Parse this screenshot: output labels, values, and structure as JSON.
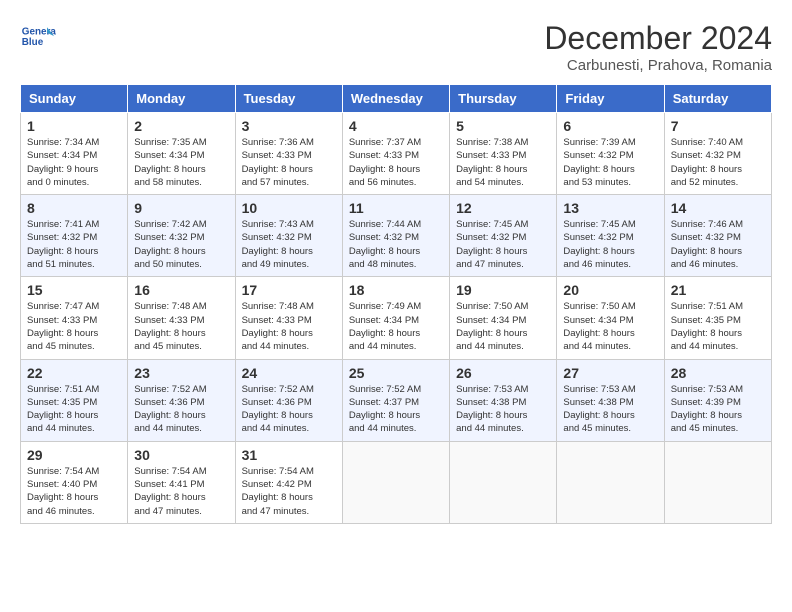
{
  "header": {
    "logo_line1": "General",
    "logo_line2": "Blue",
    "title": "December 2024",
    "subtitle": "Carbunesti, Prahova, Romania"
  },
  "days_of_week": [
    "Sunday",
    "Monday",
    "Tuesday",
    "Wednesday",
    "Thursday",
    "Friday",
    "Saturday"
  ],
  "weeks": [
    [
      {
        "day": 1,
        "info": "Sunrise: 7:34 AM\nSunset: 4:34 PM\nDaylight: 9 hours\nand 0 minutes."
      },
      {
        "day": 2,
        "info": "Sunrise: 7:35 AM\nSunset: 4:34 PM\nDaylight: 8 hours\nand 58 minutes."
      },
      {
        "day": 3,
        "info": "Sunrise: 7:36 AM\nSunset: 4:33 PM\nDaylight: 8 hours\nand 57 minutes."
      },
      {
        "day": 4,
        "info": "Sunrise: 7:37 AM\nSunset: 4:33 PM\nDaylight: 8 hours\nand 56 minutes."
      },
      {
        "day": 5,
        "info": "Sunrise: 7:38 AM\nSunset: 4:33 PM\nDaylight: 8 hours\nand 54 minutes."
      },
      {
        "day": 6,
        "info": "Sunrise: 7:39 AM\nSunset: 4:32 PM\nDaylight: 8 hours\nand 53 minutes."
      },
      {
        "day": 7,
        "info": "Sunrise: 7:40 AM\nSunset: 4:32 PM\nDaylight: 8 hours\nand 52 minutes."
      }
    ],
    [
      {
        "day": 8,
        "info": "Sunrise: 7:41 AM\nSunset: 4:32 PM\nDaylight: 8 hours\nand 51 minutes."
      },
      {
        "day": 9,
        "info": "Sunrise: 7:42 AM\nSunset: 4:32 PM\nDaylight: 8 hours\nand 50 minutes."
      },
      {
        "day": 10,
        "info": "Sunrise: 7:43 AM\nSunset: 4:32 PM\nDaylight: 8 hours\nand 49 minutes."
      },
      {
        "day": 11,
        "info": "Sunrise: 7:44 AM\nSunset: 4:32 PM\nDaylight: 8 hours\nand 48 minutes."
      },
      {
        "day": 12,
        "info": "Sunrise: 7:45 AM\nSunset: 4:32 PM\nDaylight: 8 hours\nand 47 minutes."
      },
      {
        "day": 13,
        "info": "Sunrise: 7:45 AM\nSunset: 4:32 PM\nDaylight: 8 hours\nand 46 minutes."
      },
      {
        "day": 14,
        "info": "Sunrise: 7:46 AM\nSunset: 4:32 PM\nDaylight: 8 hours\nand 46 minutes."
      }
    ],
    [
      {
        "day": 15,
        "info": "Sunrise: 7:47 AM\nSunset: 4:33 PM\nDaylight: 8 hours\nand 45 minutes."
      },
      {
        "day": 16,
        "info": "Sunrise: 7:48 AM\nSunset: 4:33 PM\nDaylight: 8 hours\nand 45 minutes."
      },
      {
        "day": 17,
        "info": "Sunrise: 7:48 AM\nSunset: 4:33 PM\nDaylight: 8 hours\nand 44 minutes."
      },
      {
        "day": 18,
        "info": "Sunrise: 7:49 AM\nSunset: 4:34 PM\nDaylight: 8 hours\nand 44 minutes."
      },
      {
        "day": 19,
        "info": "Sunrise: 7:50 AM\nSunset: 4:34 PM\nDaylight: 8 hours\nand 44 minutes."
      },
      {
        "day": 20,
        "info": "Sunrise: 7:50 AM\nSunset: 4:34 PM\nDaylight: 8 hours\nand 44 minutes."
      },
      {
        "day": 21,
        "info": "Sunrise: 7:51 AM\nSunset: 4:35 PM\nDaylight: 8 hours\nand 44 minutes."
      }
    ],
    [
      {
        "day": 22,
        "info": "Sunrise: 7:51 AM\nSunset: 4:35 PM\nDaylight: 8 hours\nand 44 minutes."
      },
      {
        "day": 23,
        "info": "Sunrise: 7:52 AM\nSunset: 4:36 PM\nDaylight: 8 hours\nand 44 minutes."
      },
      {
        "day": 24,
        "info": "Sunrise: 7:52 AM\nSunset: 4:36 PM\nDaylight: 8 hours\nand 44 minutes."
      },
      {
        "day": 25,
        "info": "Sunrise: 7:52 AM\nSunset: 4:37 PM\nDaylight: 8 hours\nand 44 minutes."
      },
      {
        "day": 26,
        "info": "Sunrise: 7:53 AM\nSunset: 4:38 PM\nDaylight: 8 hours\nand 44 minutes."
      },
      {
        "day": 27,
        "info": "Sunrise: 7:53 AM\nSunset: 4:38 PM\nDaylight: 8 hours\nand 45 minutes."
      },
      {
        "day": 28,
        "info": "Sunrise: 7:53 AM\nSunset: 4:39 PM\nDaylight: 8 hours\nand 45 minutes."
      }
    ],
    [
      {
        "day": 29,
        "info": "Sunrise: 7:54 AM\nSunset: 4:40 PM\nDaylight: 8 hours\nand 46 minutes."
      },
      {
        "day": 30,
        "info": "Sunrise: 7:54 AM\nSunset: 4:41 PM\nDaylight: 8 hours\nand 47 minutes."
      },
      {
        "day": 31,
        "info": "Sunrise: 7:54 AM\nSunset: 4:42 PM\nDaylight: 8 hours\nand 47 minutes."
      },
      null,
      null,
      null,
      null
    ]
  ]
}
